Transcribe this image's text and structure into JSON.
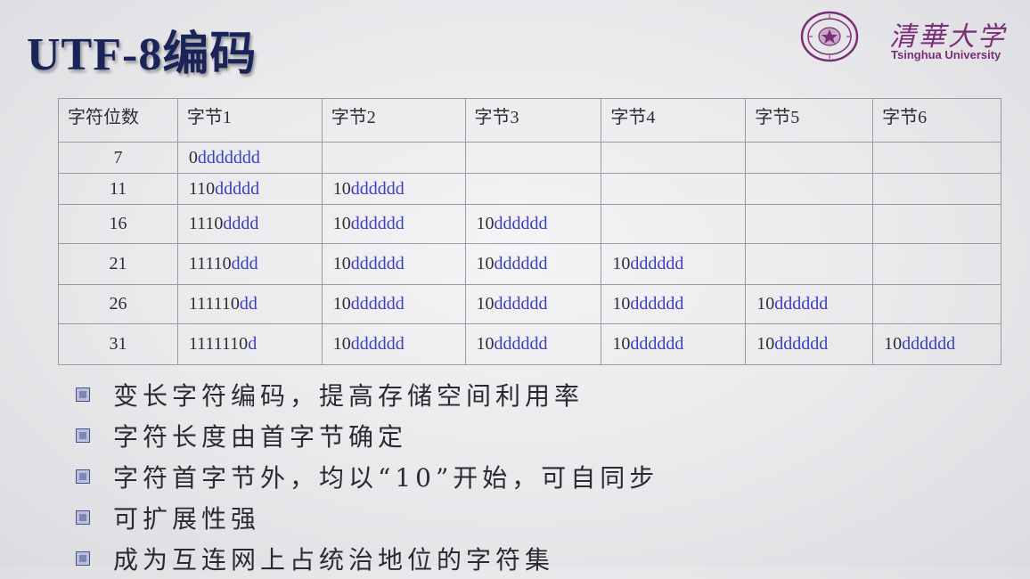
{
  "title": "UTF-8编码",
  "logo": {
    "name_cn": "清華大学",
    "name_en": "Tsinghua University"
  },
  "table": {
    "headers": [
      "字符位数",
      "字节1",
      "字节2",
      "字节3",
      "字节4",
      "字节5",
      "字节6"
    ],
    "rows": [
      {
        "bits": "7",
        "bytes": [
          {
            "prefix": "0",
            "data": "ddddddd"
          }
        ]
      },
      {
        "bits": "11",
        "bytes": [
          {
            "prefix": "110",
            "data": "ddddd"
          },
          {
            "prefix": "10",
            "data": "dddddd"
          }
        ]
      },
      {
        "bits": "16",
        "bytes": [
          {
            "prefix": "1110",
            "data": "dddd"
          },
          {
            "prefix": "10",
            "data": "dddddd"
          },
          {
            "prefix": "10",
            "data": "dddddd"
          }
        ]
      },
      {
        "bits": "21",
        "bytes": [
          {
            "prefix": "11110",
            "data": "ddd"
          },
          {
            "prefix": "10",
            "data": "dddddd"
          },
          {
            "prefix": "10",
            "data": "dddddd"
          },
          {
            "prefix": "10",
            "data": "dddddd"
          }
        ]
      },
      {
        "bits": "26",
        "bytes": [
          {
            "prefix": "111110",
            "data": "dd"
          },
          {
            "prefix": "10",
            "data": "dddddd"
          },
          {
            "prefix": "10",
            "data": "dddddd"
          },
          {
            "prefix": "10",
            "data": "dddddd"
          },
          {
            "prefix": "10",
            "data": "dddddd"
          }
        ]
      },
      {
        "bits": "31",
        "bytes": [
          {
            "prefix": "1111110",
            "data": "d"
          },
          {
            "prefix": "10",
            "data": "dddddd"
          },
          {
            "prefix": "10",
            "data": "dddddd"
          },
          {
            "prefix": "10",
            "data": "dddddd"
          },
          {
            "prefix": "10",
            "data": "dddddd"
          },
          {
            "prefix": "10",
            "data": "dddddd"
          }
        ]
      }
    ]
  },
  "bullets": [
    "变长字符编码，提高存储空间利用率",
    "字符长度由首字节确定",
    "字符首字节外，均以“10”开始，可自同步",
    "可扩展性强",
    "成为互连网上占统治地位的字符集"
  ],
  "colors": {
    "title": "#1a2459",
    "data_bits": "#3a3fc0",
    "logo": "#7b2d78",
    "bullet": "#7d86b5"
  }
}
